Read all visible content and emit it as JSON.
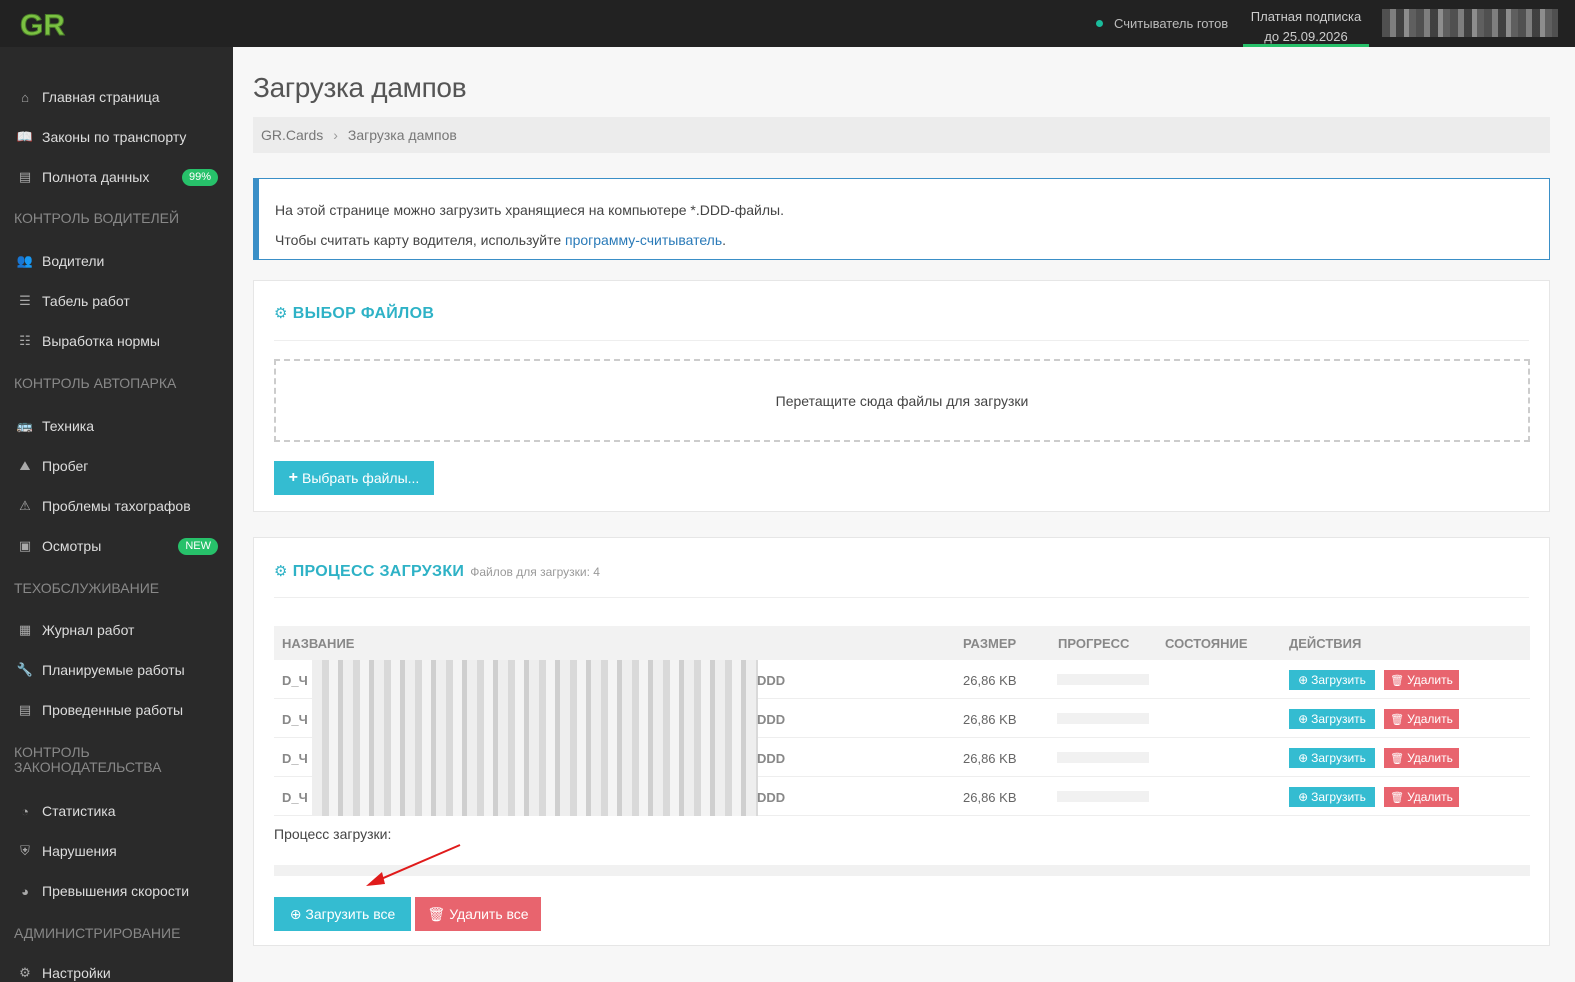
{
  "topbar": {
    "logo_text": "GR",
    "reader_status": "Считыватель готов",
    "subscription_line1": "Платная подписка",
    "subscription_line2": "до 25.09.2026",
    "accent_color": "#27c16a"
  },
  "sidebar": {
    "items": [
      {
        "label": "Главная страница",
        "icon": "home-icon"
      },
      {
        "label": "Законы по транспорту",
        "icon": "book-icon"
      },
      {
        "label": "Полнота данных",
        "icon": "chart-icon",
        "badge": "99%"
      },
      {
        "label": "Водители",
        "icon": "users-icon"
      },
      {
        "label": "Табель работ",
        "icon": "list-icon"
      },
      {
        "label": "Выработка нормы",
        "icon": "checklist-icon"
      },
      {
        "label": "Техника",
        "icon": "bus-icon"
      },
      {
        "label": "Пробег",
        "icon": "road-icon"
      },
      {
        "label": "Проблемы тахографов",
        "icon": "warning-icon"
      },
      {
        "label": "Осмотры",
        "icon": "images-icon",
        "badge": "NEW"
      },
      {
        "label": "Журнал работ",
        "icon": "calendar-icon"
      },
      {
        "label": "Планируемые работы",
        "icon": "wrench-icon"
      },
      {
        "label": "Проведенные работы",
        "icon": "table-icon"
      },
      {
        "label": "Статистика",
        "icon": "pie-icon"
      },
      {
        "label": "Нарушения",
        "icon": "shield-icon"
      },
      {
        "label": "Превышения скорости",
        "icon": "gauge-icon"
      },
      {
        "label": "Настройки",
        "icon": "gears-icon"
      }
    ],
    "sections": [
      "Контроль водителей",
      "Контроль автопарка",
      "Техобслуживание",
      "Контроль законодательства",
      "Администрирование"
    ]
  },
  "page": {
    "title": "Загрузка дампов",
    "breadcrumb": [
      "GR.Cards",
      "Загрузка дампов"
    ]
  },
  "info": {
    "line1": "На этой странице можно загрузить хранящиеся на компьютере *.DDD-файлы.",
    "line2_prefix": "Чтобы считать карту водителя, используйте ",
    "line2_link": "программу-считыватель",
    "line2_suffix": "."
  },
  "file_select": {
    "title": "ВЫБОР ФАЙЛОВ",
    "dropzone_text": "Перетащите сюда файлы для загрузки",
    "choose_button": "Выбрать файлы..."
  },
  "upload": {
    "title": "ПРОЦЕСС ЗАГРУЗКИ",
    "files_count_text": "Файлов для загрузки: 4",
    "columns": [
      "НАЗВАНИЕ",
      "РАЗМЕР",
      "ПРОГРЕСС",
      "СОСТОЯНИЕ",
      "ДЕЙСТВИЯ"
    ],
    "rows": [
      {
        "name_prefix": "D_Ч",
        "name_suffix": "DDD",
        "size": "26,86 KB",
        "progress": 0,
        "status": ""
      },
      {
        "name_prefix": "D_Ч",
        "name_suffix": "DDD",
        "size": "26,86 KB",
        "progress": 0,
        "status": ""
      },
      {
        "name_prefix": "D_Ч",
        "name_suffix": "DDD",
        "size": "26,86 KB",
        "progress": 0,
        "status": ""
      },
      {
        "name_prefix": "D_Ч",
        "name_suffix": "DDD",
        "size": "26,86 KB",
        "progress": 0,
        "status": ""
      }
    ],
    "row_upload_label": "Загрузить",
    "row_delete_label": "Удалить",
    "total_label": "Процесс загрузки:",
    "total_progress": 0,
    "upload_all_label": "Загрузить все",
    "delete_all_label": "Удалить все"
  }
}
